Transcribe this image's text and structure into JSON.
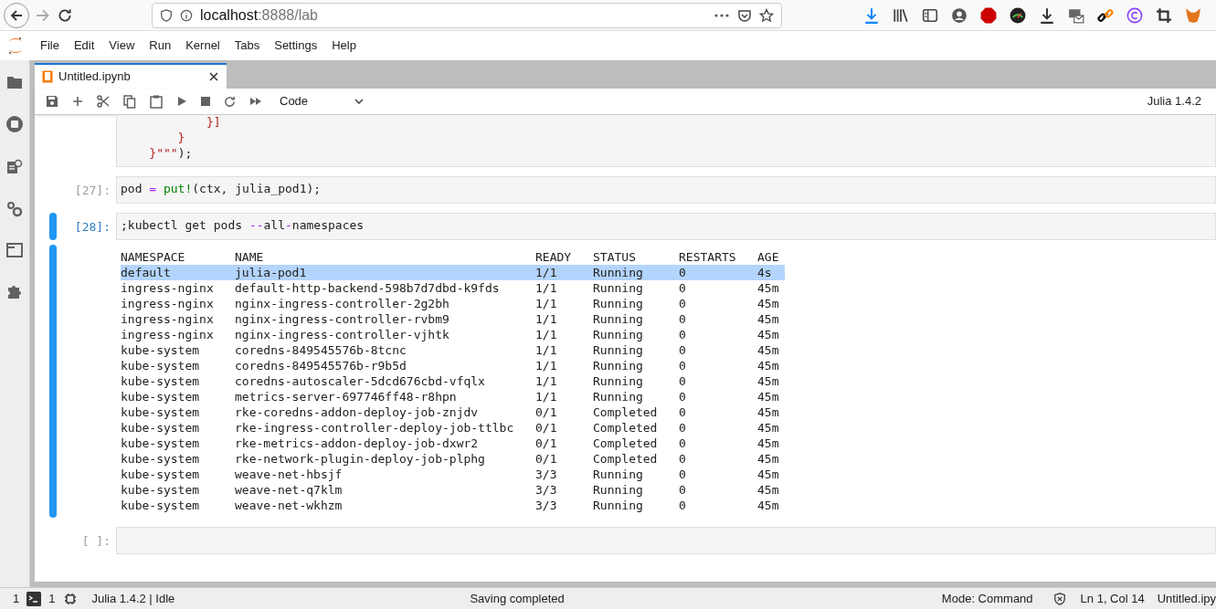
{
  "browser": {
    "url_host": "localhost",
    "url_rest": ":8888/lab"
  },
  "menu": [
    "File",
    "Edit",
    "View",
    "Run",
    "Kernel",
    "Tabs",
    "Settings",
    "Help"
  ],
  "tab": {
    "title": "Untitled.ipynb"
  },
  "toolbar": {
    "cell_type": "Code",
    "kernel": "Julia 1.4.2"
  },
  "cells": [
    {
      "selected": false,
      "lines": [
        [
          {
            "text": "            }]",
            "kind": "string"
          }
        ],
        [
          {
            "text": "        }",
            "kind": "string"
          }
        ],
        [
          {
            "text": "    }\"\"\"",
            "kind": "string"
          },
          {
            "text": ");",
            "kind": "plain"
          }
        ]
      ]
    },
    {
      "prompt": "[27]:",
      "selected": false,
      "lines": [
        [
          {
            "text": "pod ",
            "kind": "plain"
          },
          {
            "text": "=",
            "kind": "operator"
          },
          {
            "text": " put!",
            "kind": "builtin"
          },
          {
            "text": "(ctx, julia_pod1);",
            "kind": "plain"
          }
        ]
      ]
    },
    {
      "prompt": "[28]:",
      "selected": true,
      "lines": [
        [
          {
            "text": ";kubectl get pods ",
            "kind": "plain"
          },
          {
            "text": "--",
            "kind": "operator"
          },
          {
            "text": "all",
            "kind": "plain"
          },
          {
            "text": "-",
            "kind": "operator"
          },
          {
            "text": "namespaces",
            "kind": "plain"
          }
        ]
      ],
      "output": {
        "columns": [
          "NAMESPACE",
          "NAME",
          "READY",
          "STATUS",
          "RESTARTS",
          "AGE"
        ],
        "rows": [
          {
            "selected": true,
            "cells": [
              "default",
              "julia-pod1",
              "1/1",
              "Running",
              "0",
              "4s"
            ]
          },
          {
            "selected": false,
            "cells": [
              "ingress-nginx",
              "default-http-backend-598b7d7dbd-k9fds",
              "1/1",
              "Running",
              "0",
              "45m"
            ]
          },
          {
            "selected": false,
            "cells": [
              "ingress-nginx",
              "nginx-ingress-controller-2g2bh",
              "1/1",
              "Running",
              "0",
              "45m"
            ]
          },
          {
            "selected": false,
            "cells": [
              "ingress-nginx",
              "nginx-ingress-controller-rvbm9",
              "1/1",
              "Running",
              "0",
              "45m"
            ]
          },
          {
            "selected": false,
            "cells": [
              "ingress-nginx",
              "nginx-ingress-controller-vjhtk",
              "1/1",
              "Running",
              "0",
              "45m"
            ]
          },
          {
            "selected": false,
            "cells": [
              "kube-system",
              "coredns-849545576b-8tcnc",
              "1/1",
              "Running",
              "0",
              "45m"
            ]
          },
          {
            "selected": false,
            "cells": [
              "kube-system",
              "coredns-849545576b-r9b5d",
              "1/1",
              "Running",
              "0",
              "45m"
            ]
          },
          {
            "selected": false,
            "cells": [
              "kube-system",
              "coredns-autoscaler-5dcd676cbd-vfqlx",
              "1/1",
              "Running",
              "0",
              "45m"
            ]
          },
          {
            "selected": false,
            "cells": [
              "kube-system",
              "metrics-server-697746ff48-r8hpn",
              "1/1",
              "Running",
              "0",
              "45m"
            ]
          },
          {
            "selected": false,
            "cells": [
              "kube-system",
              "rke-coredns-addon-deploy-job-znjdv",
              "0/1",
              "Completed",
              "0",
              "45m"
            ]
          },
          {
            "selected": false,
            "cells": [
              "kube-system",
              "rke-ingress-controller-deploy-job-ttlbc",
              "0/1",
              "Completed",
              "0",
              "45m"
            ]
          },
          {
            "selected": false,
            "cells": [
              "kube-system",
              "rke-metrics-addon-deploy-job-dxwr2",
              "0/1",
              "Completed",
              "0",
              "45m"
            ]
          },
          {
            "selected": false,
            "cells": [
              "kube-system",
              "rke-network-plugin-deploy-job-plphg",
              "0/1",
              "Completed",
              "0",
              "45m"
            ]
          },
          {
            "selected": false,
            "cells": [
              "kube-system",
              "weave-net-hbsjf",
              "3/3",
              "Running",
              "0",
              "45m"
            ]
          },
          {
            "selected": false,
            "cells": [
              "kube-system",
              "weave-net-q7klm",
              "3/3",
              "Running",
              "0",
              "45m"
            ]
          },
          {
            "selected": false,
            "cells": [
              "kube-system",
              "weave-net-wkhzm",
              "3/3",
              "Running",
              "0",
              "45m"
            ]
          }
        ]
      }
    },
    {
      "prompt": "[ ]:",
      "selected": false
    }
  ],
  "status_bar": {
    "terminals": "1",
    "kernels": "1",
    "kernel_status": "Julia 1.4.2 | Idle",
    "message": "Saving completed",
    "mode": "Mode: Command",
    "position": "Ln 1, Col 14",
    "file": "Untitled.ipy"
  }
}
